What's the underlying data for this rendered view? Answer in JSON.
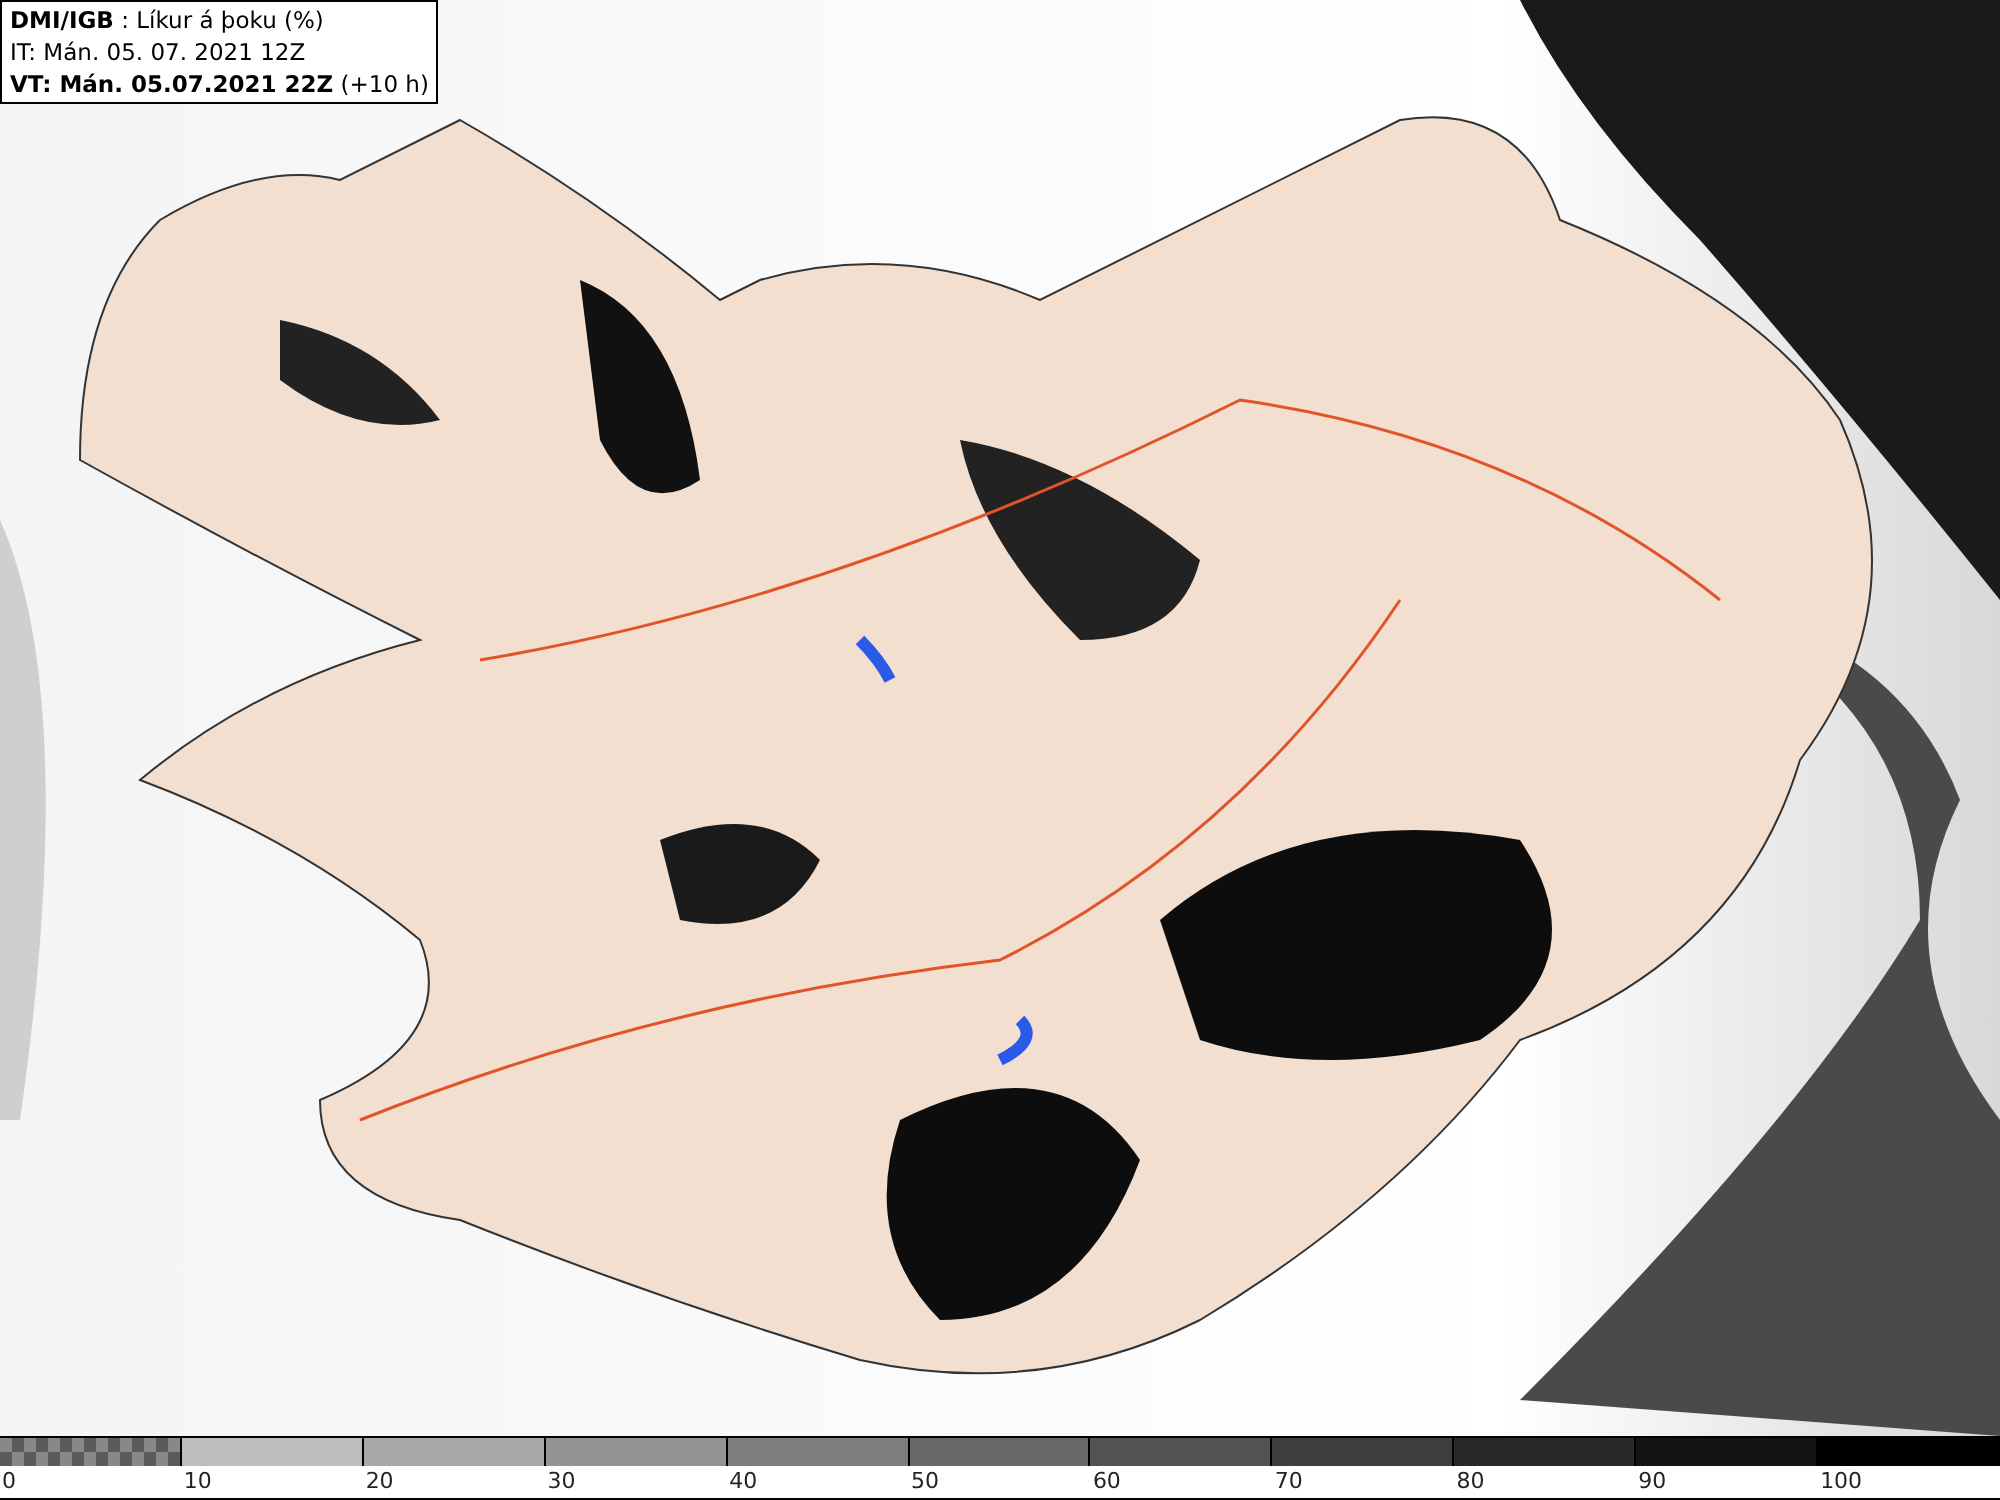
{
  "header": {
    "lines": [
      "**DMI/IGB** : Líkur á þoku (%)",
      "IT: Mán. 05. 07. 2021 12Z",
      "**VT: Mán. 05.07.2021 22Z** (+10 h)"
    ]
  },
  "legend": [
    {
      "label": "0",
      "kind": "checker",
      "color": "#5a5a5a"
    },
    {
      "label": "10",
      "kind": "solid",
      "color": "#bdbdbd"
    },
    {
      "label": "20",
      "kind": "solid",
      "color": "#a8a8a8"
    },
    {
      "label": "30",
      "kind": "solid",
      "color": "#939393"
    },
    {
      "label": "40",
      "kind": "solid",
      "color": "#7d7d7d"
    },
    {
      "label": "50",
      "kind": "solid",
      "color": "#686868"
    },
    {
      "label": "60",
      "kind": "solid",
      "color": "#535353"
    },
    {
      "label": "70",
      "kind": "solid",
      "color": "#3e3e3e"
    },
    {
      "label": "80",
      "kind": "solid",
      "color": "#292929"
    },
    {
      "label": "90",
      "kind": "solid",
      "color": "#141414"
    },
    {
      "label": "100",
      "kind": "solid",
      "color": "#000000"
    }
  ]
}
